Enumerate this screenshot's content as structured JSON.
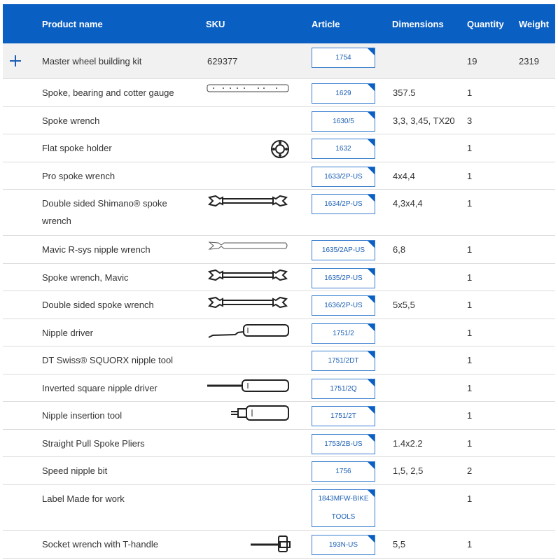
{
  "columns": {
    "product_name": "Product name",
    "sku": "SKU",
    "article": "Article",
    "dimensions": "Dimensions",
    "quantity": "Quantity",
    "weight": "Weight"
  },
  "kit": {
    "name": "Master wheel building kit",
    "sku": "629377",
    "article": "1754",
    "dimensions": "",
    "quantity": "19",
    "weight": "2319",
    "expand_icon": "plus-icon"
  },
  "items": [
    {
      "name": "Spoke, bearing and cotter gauge",
      "article": "1629",
      "dimensions": "357.5",
      "quantity": "1",
      "image": "gauge-ruler-image"
    },
    {
      "name": "Spoke wrench",
      "article": "1630/5",
      "dimensions": "3,3, 3,45, TX20",
      "quantity": "3",
      "image": ""
    },
    {
      "name": "Flat spoke holder",
      "article": "1632",
      "dimensions": "",
      "quantity": "1",
      "image": "spoke-holder-image"
    },
    {
      "name": "Pro spoke wrench",
      "article": "1633/2P-US",
      "dimensions": "4x4,4",
      "quantity": "1",
      "image": ""
    },
    {
      "name": "Double sided Shimano® spoke wrench",
      "article": "1634/2P-US",
      "dimensions": "4,3x4,4",
      "quantity": "1",
      "image": "double-wrench-image"
    },
    {
      "name": "Mavic R-sys nipple wrench",
      "article": "1635/2AP-US",
      "dimensions": "6,8",
      "quantity": "1",
      "image": "mavic-wrench-image"
    },
    {
      "name": "Spoke wrench, Mavic",
      "article": "1635/2P-US",
      "dimensions": "",
      "quantity": "1",
      "image": "double-wrench-image"
    },
    {
      "name": "Double sided spoke wrench",
      "article": "1636/2P-US",
      "dimensions": "5x5,5",
      "quantity": "1",
      "image": "double-wrench-image"
    },
    {
      "name": "Nipple driver",
      "article": "1751/2",
      "dimensions": "",
      "quantity": "1",
      "image": "nipple-driver-image"
    },
    {
      "name": "DT Swiss® SQUORX nipple tool",
      "article": "1751/2DT",
      "dimensions": "",
      "quantity": "1",
      "image": ""
    },
    {
      "name": "Inverted square nipple driver",
      "article": "1751/2Q",
      "dimensions": "",
      "quantity": "1",
      "image": "screwdriver-image"
    },
    {
      "name": "Nipple insertion tool",
      "article": "1751/2T",
      "dimensions": "",
      "quantity": "1",
      "image": "insertion-tool-image"
    },
    {
      "name": "Straight Pull Spoke Pliers",
      "article": "1753/2B-US",
      "dimensions": "1.4x2.2",
      "quantity": "1",
      "image": ""
    },
    {
      "name": "Speed nipple bit",
      "article": "1756",
      "dimensions": "1,5, 2,5",
      "quantity": "2",
      "image": ""
    },
    {
      "name": "Label Made for work",
      "article": "1843MFW-BIKE TOOLS",
      "dimensions": "",
      "quantity": "1",
      "image": ""
    },
    {
      "name": "Socket wrench with T-handle",
      "article": "193N-US",
      "dimensions": "5,5",
      "quantity": "1",
      "image": "t-handle-image"
    }
  ],
  "colors": {
    "header_bg": "#0a5fc2",
    "link": "#1b5fb5",
    "kit_row_bg": "#f1f1f1"
  }
}
